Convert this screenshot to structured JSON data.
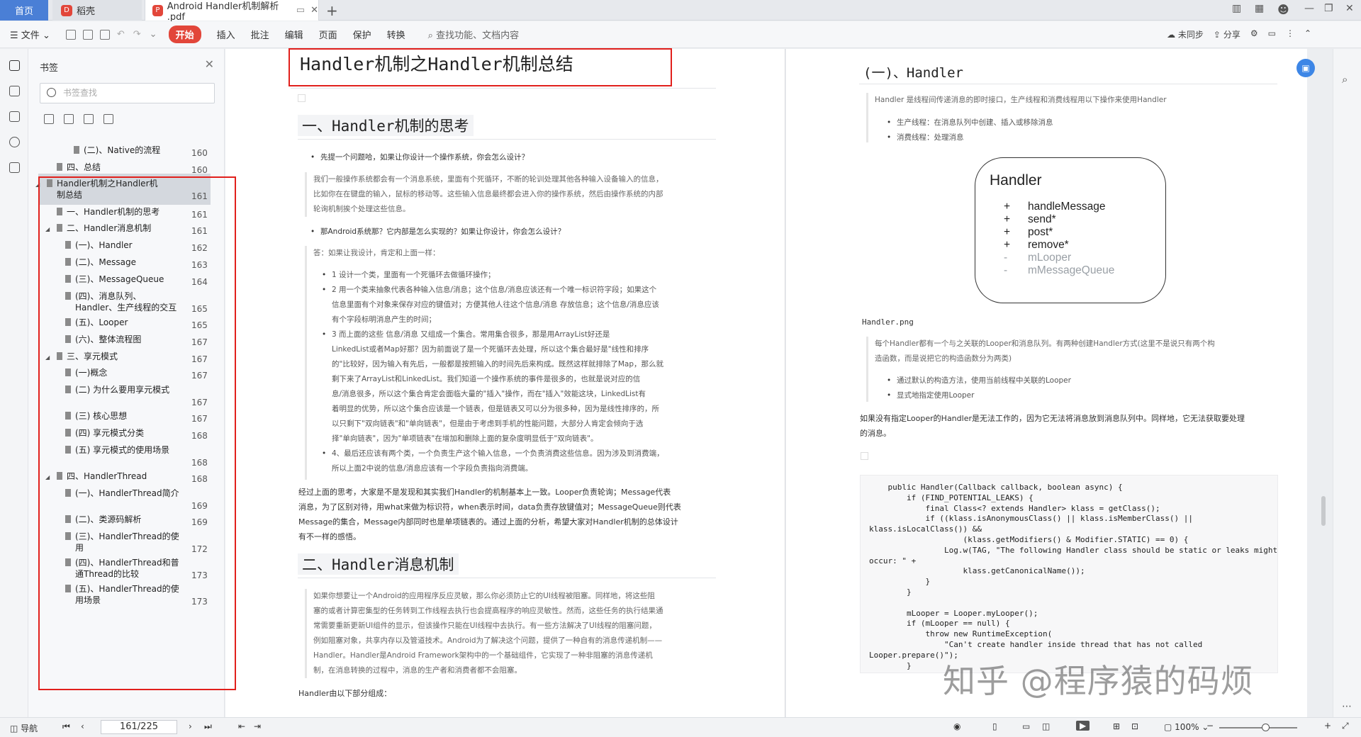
{
  "tabs": {
    "home": "首页",
    "daoke": "稻壳",
    "pdf": "Android Handler机制解析 .pdf"
  },
  "menu": {
    "file": "文件",
    "start": "开始",
    "insert": "插入",
    "annotate": "批注",
    "edit": "编辑",
    "page": "页面",
    "protect": "保护",
    "convert": "转换",
    "search": "查找功能、文档内容",
    "unsynced": "未同步",
    "share": "分享"
  },
  "bookmarks": {
    "title": "书签",
    "search_placeholder": "书签查找",
    "items": [
      {
        "label": "(二)、Native的流程",
        "page": "160"
      },
      {
        "label": "四、总结",
        "page": "160"
      },
      {
        "label": "Handler机制之Handler机制总结",
        "page": "161"
      },
      {
        "label": "一、Handler机制的思考",
        "page": "161"
      },
      {
        "label": "二、Handler消息机制",
        "page": "161"
      },
      {
        "label": "(一)、Handler",
        "page": "162"
      },
      {
        "label": "(二)、Message",
        "page": "163"
      },
      {
        "label": "(三)、MessageQueue",
        "page": "164"
      },
      {
        "label": "(四)、消息队列、Handler、生产线程的交互",
        "page": "165"
      },
      {
        "label": "(五)、Looper",
        "page": "165"
      },
      {
        "label": "(六)、整体流程图",
        "page": "167"
      },
      {
        "label": "三、享元模式",
        "page": "167"
      },
      {
        "label": "(一)概念",
        "page": "167"
      },
      {
        "label": "(二) 为什么要用享元模式",
        "page": "167"
      },
      {
        "label": "(三) 核心思想",
        "page": "167"
      },
      {
        "label": "(四) 享元模式分类",
        "page": "168"
      },
      {
        "label": "(五) 享元模式的使用场景",
        "page": "168"
      },
      {
        "label": "四、HandlerThread",
        "page": "168"
      },
      {
        "label": "(一)、HandlerThread简介",
        "page": "169"
      },
      {
        "label": "(二)、类源码解析",
        "page": "169"
      },
      {
        "label": "(三)、HandlerThread的使用",
        "page": "172"
      },
      {
        "label": "(四)、HandlerThread和普通Thread的比较",
        "page": "173"
      },
      {
        "label": "(五)、HandlerThread的使用场景",
        "page": "173"
      }
    ]
  },
  "doc_left": {
    "title": "Handler机制之Handler机制总结",
    "h_think": "一、Handler机制的思考",
    "b1": "先提一个问题哈，如果让你设计一个操作系统，你会怎么设计？",
    "q1a": "我们一般操作系统都会有一个消息系统，里面有个死循环，不断的轮训处理其他各种输入设备输入的信息，",
    "q1b": "比如你在在键盘的输入，鼠标的移动等。这些输入信息最终都会进入你的操作系统，然后由操作系统的内部",
    "q1c": "轮询机制挨个处理这些信息。",
    "b2": "那Android系统那？它内部是怎么实现的？如果让你设计，你会怎么设计？",
    "ans": "答：如果让我设计，肯定和上面一样：",
    "s1": "1 设计一个类，里面有一个死循环去做循环操作；",
    "s2a": "2 用一个类来抽象代表各种输入信息/消息；这个信息/消息应该还有一个唯一标识符字段；如果这个",
    "s2b": "信息里面有个对象来保存对应的键值对；方便其他人往这个信息/消息 存放信息；这个信息/消息应该",
    "s2c": "有个字段标明消息产生的时间；",
    "s3a": "3 而上面的这些 信息/消息 又组成一个集合。常用集合很多，那是用ArrayList好还是",
    "s3b": "LinkedList或者Map好那？因为前面说了是一个死循环去处理，所以这个集合最好是\"线性和排序",
    "s3c": "的\"比较好，因为输入有先后，一般都是按照输入的时间先后来构成。既然这样就排除了Map，那么就",
    "s3d": "剩下来了ArrayList和LinkedList。我们知道一个操作系统的事件是很多的，也就是说对应的信",
    "s3e": "息/消息很多，所以这个集合肯定会面临大量的\"插入\"操作，而在\"插入\"效能这块，LinkedList有",
    "s3f": "着明显的优势，所以这个集合应该是一个链表，但是链表又可以分为很多种，因为是线性排序的，所",
    "s3g": "以只剩下\"双向链表\"和\"单向链表\"，但是由于考虑到手机的性能问题，大部分人肯定会倾向于选",
    "s3h": "择\"单向链表\"，因为\"单项链表\"在增加和删除上面的复杂度明显低于\"双向链表\"。",
    "s4a": "4、最后还应该有两个类，一个负责生产这个输入信息，一个负责消费这些信息。因为涉及到消费端，",
    "s4b": "所以上面2中说的信息/消息应该有一个字段负责指向消费端。",
    "p1a": "经过上面的思考，大家是不是发现和其实我们Handler的机制基本上一致。Looper负责轮询；Message代表",
    "p1b": "消息，为了区别对待，用what来做为标识符，when表示时间，data负责存放键值对；MessageQueue则代表",
    "p1c": "Message的集合，Message内部同时也是单项链表的。通过上面的分析，希望大家对Handler机制的总体设计",
    "p1d": "有不一样的感悟。",
    "h_msg": "二、Handler消息机制",
    "q2a": "如果你想要让一个Android的应用程序反应灵敏，那么你必须防止它的UI线程被阻塞。同样地，将这些阻",
    "q2b": "塞的或者计算密集型的任务转到工作线程去执行也会提高程序的响应灵敏性。然而，这些任务的执行结果通",
    "q2c": "常需要重新更新UI组件的显示，但该操作只能在UI线程中去执行。有一些方法解决了UI线程的阻塞问题，",
    "q2d": "例如阻塞对象，共享内存以及管道技术。Android为了解决这个问题，提供了一种自有的消息传递机制——",
    "q2e": "Handler。Handler是Android Framework架构中的一个基础组件，它实现了一种非阻塞的消息传递机",
    "q2f": "制，在消息转换的过程中，消息的生产者和消费者都不会阻塞。",
    "p2": "Handler由以下部分组成："
  },
  "doc_right": {
    "h_handler": "(一)、Handler",
    "q1": "Handler 是线程间传递消息的即时接口，生产线程和消费线程用以下操作来使用Handler",
    "b1": "生产线程：在消息队列中创建、插入或移除消息",
    "b2": "消费线程：处理消息",
    "diagram": {
      "title": "Handler",
      "members": [
        {
          "sym": "+",
          "name": "handleMessage",
          "public": true
        },
        {
          "sym": "+",
          "name": "send*",
          "public": true
        },
        {
          "sym": "+",
          "name": "post*",
          "public": true
        },
        {
          "sym": "+",
          "name": "remove*",
          "public": true
        },
        {
          "sym": "-",
          "name": "mLooper",
          "public": false
        },
        {
          "sym": "-",
          "name": "mMessageQueue",
          "public": false
        }
      ]
    },
    "caption": "Handler.png",
    "q2a": "每个Handler都有一个与之关联的Looper和消息队列。有两种创建Handler方式(这里不是说只有两个构",
    "q2b": "造函数，而是说把它的构造函数分为两类)",
    "b3": "通过默认的构造方法，使用当前线程中关联的Looper",
    "b4": "显式地指定使用Looper",
    "p1a": "如果没有指定Looper的Handler是无法工作的，因为它无法将消息放到消息队列中。同样地，它无法获取要处理",
    "p1b": "的消息。",
    "code": [
      "    public Handler(Callback callback, boolean async) {",
      "        if (FIND_POTENTIAL_LEAKS) {",
      "            final Class<? extends Handler> klass = getClass();",
      "            if ((klass.isAnonymousClass() || klass.isMemberClass() ||",
      "klass.isLocalClass()) &&",
      "                    (klass.getModifiers() & Modifier.STATIC) == 0) {",
      "                Log.w(TAG, \"The following Handler class should be static or leaks might",
      "occur: \" +",
      "                    klass.getCanonicalName());",
      "            }",
      "        }",
      "",
      "        mLooper = Looper.myLooper();",
      "        if (mLooper == null) {",
      "            throw new RuntimeException(",
      "                \"Can't create handler inside thread that has not called",
      "Looper.prepare()\");",
      "        }"
    ]
  },
  "watermark": "知乎 @程序猿的码烦",
  "status": {
    "nav": "导航",
    "page": "161/225",
    "zoom": "100%"
  },
  "colors": {
    "accent": "#e2463a",
    "highlight_box": "#e1201c",
    "home_tab": "#4a7fd6"
  }
}
